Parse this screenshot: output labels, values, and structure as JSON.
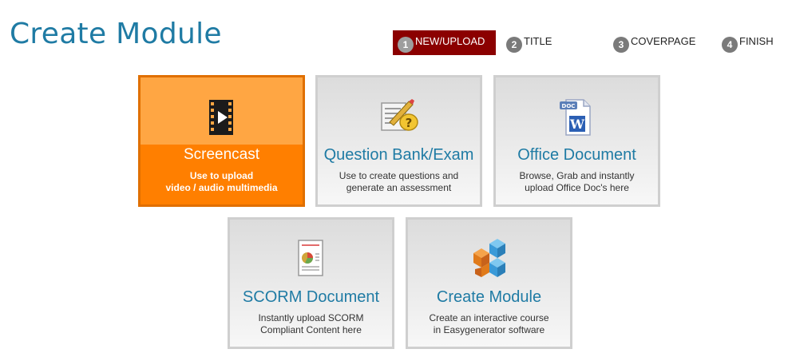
{
  "page": {
    "title": "Create Module"
  },
  "steps": [
    {
      "num": "1",
      "label": "NEW/UPLOAD",
      "active": true
    },
    {
      "num": "2",
      "label": "TITLE",
      "active": false
    },
    {
      "num": "3",
      "label": "COVERPAGE",
      "active": false
    },
    {
      "num": "4",
      "label": "FINISH",
      "active": false
    }
  ],
  "tiles": [
    {
      "title": "Screencast",
      "desc_line1": "Use to upload",
      "desc_line2": "video / audio multimedia",
      "icon": "film-play-icon",
      "selected": true
    },
    {
      "title": "Question Bank/Exam",
      "desc_line1": "Use to create questions and",
      "desc_line2": "generate an assessment",
      "icon": "question-edit-icon",
      "selected": false
    },
    {
      "title": "Office Document",
      "desc_line1": "Browse, Grab and instantly",
      "desc_line2": "upload Office Doc's here",
      "icon": "word-doc-icon",
      "selected": false
    },
    {
      "title": "SCORM Document",
      "desc_line1": "Instantly upload SCORM",
      "desc_line2": "Compliant Content here",
      "icon": "report-chart-icon",
      "selected": false
    },
    {
      "title": "Create Module",
      "desc_line1": "Create an interactive course",
      "desc_line2": "in Easygenerator software",
      "icon": "cubes-icon",
      "selected": false
    }
  ],
  "colors": {
    "title_blue": "#1f7ba4",
    "active_step": "#8b0000",
    "selected_tile": "#ff7f00",
    "selected_tile_top": "#ffa643"
  }
}
